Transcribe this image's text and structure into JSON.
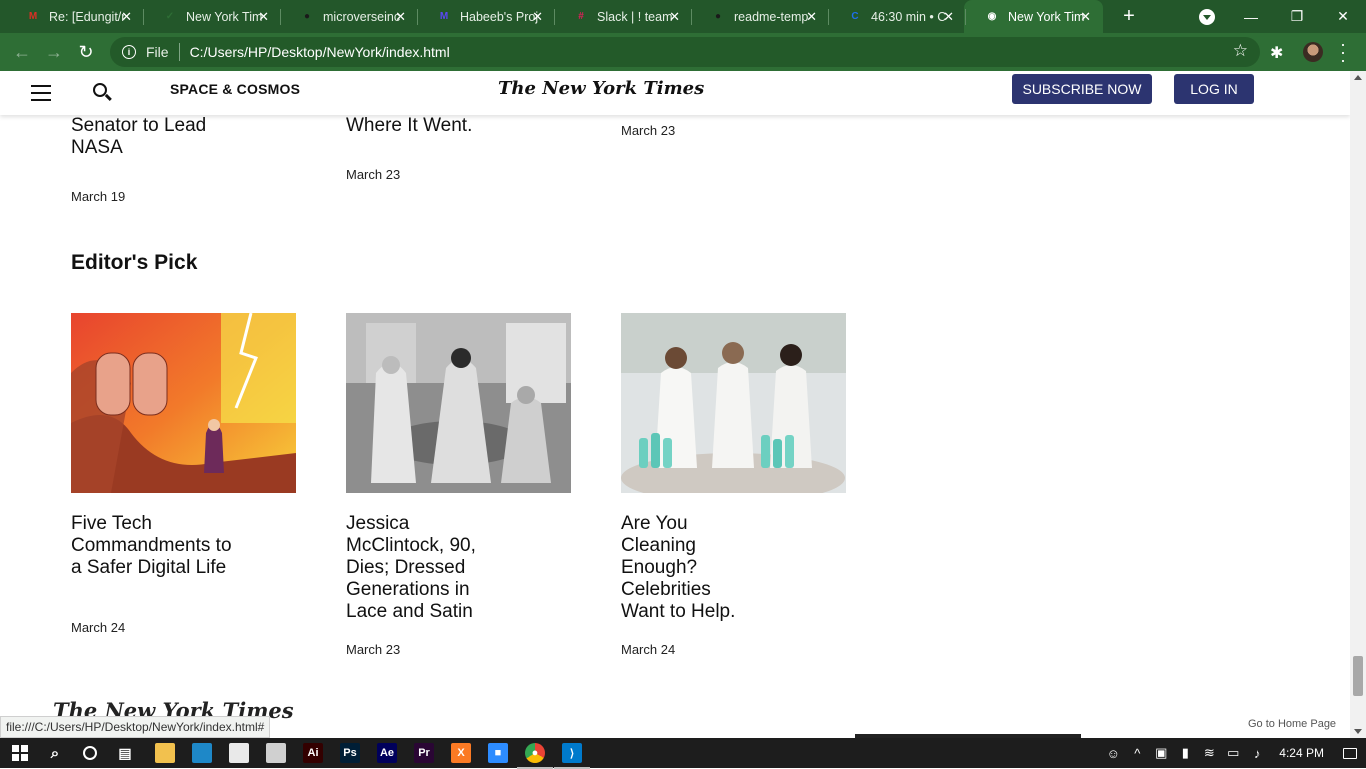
{
  "browser": {
    "tabs": [
      {
        "label": "Re: [Edungit/r",
        "favicon": "gmail-icon",
        "color": "#d93025",
        "glyph": "M"
      },
      {
        "label": "New York Tim",
        "favicon": "github-check-icon",
        "color": "#2e6e35",
        "glyph": "✓"
      },
      {
        "label": "microverseinc",
        "favicon": "github-icon",
        "color": "#1a1a1a",
        "glyph": "●"
      },
      {
        "label": "Habeeb's Proj",
        "favicon": "miro-icon",
        "color": "#5b47f5",
        "glyph": "M"
      },
      {
        "label": "Slack | ! team",
        "favicon": "slack-icon",
        "color": "#e01e5a",
        "glyph": "#"
      },
      {
        "label": "readme-temp",
        "favicon": "github-icon",
        "color": "#1a1a1a",
        "glyph": "●"
      },
      {
        "label": "46:30 min • C",
        "favicon": "codecademy-icon",
        "color": "#1f6feb",
        "glyph": "C"
      },
      {
        "label": "New York Tim",
        "favicon": "globe-icon",
        "color": "#ffffff",
        "glyph": "◉",
        "active": true
      }
    ],
    "omnibox": {
      "scheme": "File",
      "url": "C:/Users/HP/Desktop/NewYork/index.html"
    },
    "status_url": "file:///C:/Users/HP/Desktop/NewYork/index.html#"
  },
  "header": {
    "section": "SPACE & COSMOS",
    "masthead": "The New York Times",
    "subscribe": "SUBSCRIBE NOW",
    "login": "LOG IN"
  },
  "previous_row": [
    {
      "title": "Former Florida Senator to Lead NASA",
      "date": "March 19"
    },
    {
      "title": "This Might Be Where It Went.",
      "date": "March 23"
    },
    {
      "title": "",
      "date": "March 23"
    }
  ],
  "editors_pick": {
    "heading": "Editor's Pick",
    "cards": [
      {
        "title": "Five Tech Commandments to a Safer Digital Life",
        "date": "March 24"
      },
      {
        "title": "Jessica McClintock, 90, Dies; Dressed Generations in Lace and Satin",
        "date": "March 23"
      },
      {
        "title": "Are You Cleaning Enough? Celebrities Want to Help.",
        "date": "March 24"
      }
    ]
  },
  "footer": {
    "logo": "The New York Times",
    "home_link": "Go to Home Page"
  },
  "taskbar": {
    "time": "4:24 PM",
    "apps": [
      {
        "name": "file-explorer-icon",
        "color": "#f2c14e",
        "glyph": ""
      },
      {
        "name": "edge-icon",
        "color": "#1e88c8",
        "glyph": ""
      },
      {
        "name": "store-icon",
        "color": "#e9e9e9",
        "glyph": ""
      },
      {
        "name": "mail-icon",
        "color": "#d0d0d0",
        "glyph": ""
      },
      {
        "name": "illustrator-icon",
        "color": "#330000",
        "glyph": "Ai"
      },
      {
        "name": "photoshop-icon",
        "color": "#001e36",
        "glyph": "Ps"
      },
      {
        "name": "after-effects-icon",
        "color": "#00005b",
        "glyph": "Ae"
      },
      {
        "name": "premiere-icon",
        "color": "#2a0634",
        "glyph": "Pr"
      },
      {
        "name": "xampp-icon",
        "color": "#fb7a24",
        "glyph": "X"
      },
      {
        "name": "zoom-icon",
        "color": "#2d8cff",
        "glyph": "■"
      },
      {
        "name": "chrome-icon",
        "color": "#34a853",
        "glyph": "●"
      },
      {
        "name": "vscode-icon",
        "color": "#007acc",
        "glyph": "⟩"
      }
    ]
  }
}
